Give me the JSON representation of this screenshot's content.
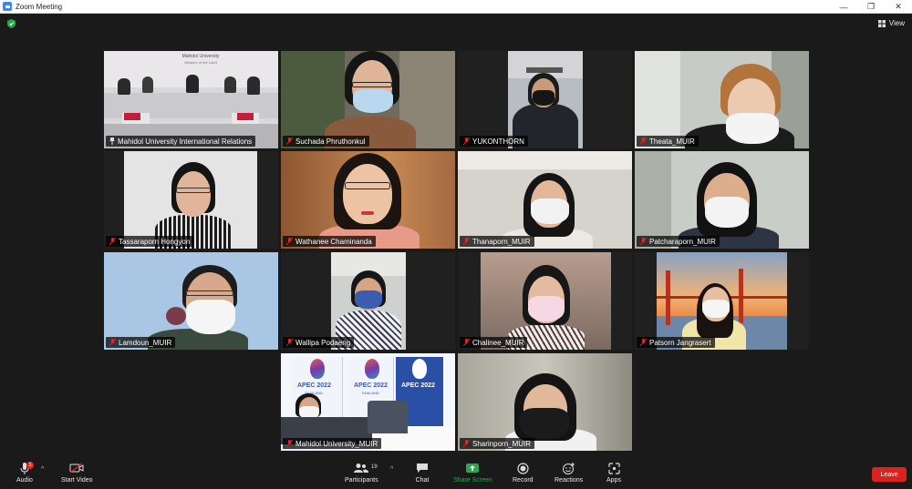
{
  "window": {
    "title": "Zoom Meeting",
    "min": "—",
    "max": "❐",
    "close": "✕"
  },
  "topbar": {
    "view_label": "View"
  },
  "participants": [
    {
      "name": "Mahidol University International Relations",
      "muted": false
    },
    {
      "name": "Suchada Phruthonkul",
      "muted": true,
      "active": true
    },
    {
      "name": "YUKONTHORN",
      "muted": true
    },
    {
      "name": "Theata_MUIR",
      "muted": true
    },
    {
      "name": "Tassaraporn Hongyon",
      "muted": true
    },
    {
      "name": "Wathanee Chaminanda",
      "muted": true
    },
    {
      "name": "Thanaporn_MUIR",
      "muted": true
    },
    {
      "name": "Patcharaporn_MUIR",
      "muted": true
    },
    {
      "name": "Lamdoun_MUIR",
      "muted": true
    },
    {
      "name": "Wallipa Podaeng",
      "muted": true
    },
    {
      "name": "Chalinee_MUIR",
      "muted": true
    },
    {
      "name": "Patsorn Jangrasert",
      "muted": true
    },
    {
      "name": "Mahidol University_MUIR",
      "muted": true
    },
    {
      "name": "Sharinporn_MUIR",
      "muted": true
    }
  ],
  "video_text": {
    "room_banner_1": "Mahidol University",
    "room_banner_2": "Wisdom of the Land",
    "apec_text": "APEC 2022",
    "apec_country": "THAILAND"
  },
  "toolbar": {
    "audio": "Audio",
    "audio_badge": "1",
    "start_video": "Start Video",
    "participants": "Participants",
    "participants_count": "19",
    "chat": "Chat",
    "share_screen": "Share Screen",
    "record": "Record",
    "reactions": "Reactions",
    "apps": "Apps",
    "leave": "Leave"
  },
  "colors": {
    "share_green": "#2da44e",
    "leave_red": "#d9231e",
    "active_speaker": "#9fd36e"
  }
}
